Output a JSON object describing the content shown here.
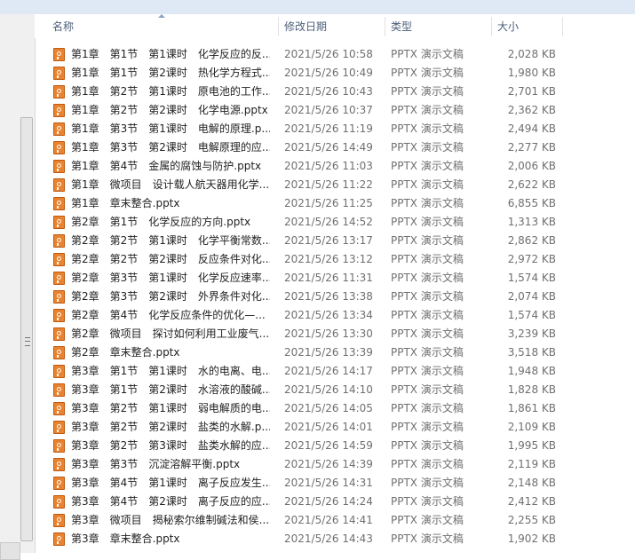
{
  "columns": {
    "name": "名称",
    "date": "修改日期",
    "type": "类型",
    "size": "大小"
  },
  "files": [
    {
      "name": "第1章　第1节　第1课时　化学反应的反...",
      "date": "2021/5/26 10:58",
      "type": "PPTX 演示文稿",
      "size": "2,028 KB"
    },
    {
      "name": "第1章　第1节　第2课时　热化学方程式...",
      "date": "2021/5/26 10:49",
      "type": "PPTX 演示文稿",
      "size": "1,980 KB"
    },
    {
      "name": "第1章　第2节　第1课时　原电池的工作...",
      "date": "2021/5/26 10:43",
      "type": "PPTX 演示文稿",
      "size": "2,701 KB"
    },
    {
      "name": "第1章　第2节　第2课时　化学电源.pptx",
      "date": "2021/5/26 10:37",
      "type": "PPTX 演示文稿",
      "size": "2,362 KB"
    },
    {
      "name": "第1章　第3节　第1课时　电解的原理.p...",
      "date": "2021/5/26 11:19",
      "type": "PPTX 演示文稿",
      "size": "2,494 KB"
    },
    {
      "name": "第1章　第3节　第2课时　电解原理的应...",
      "date": "2021/5/26 14:49",
      "type": "PPTX 演示文稿",
      "size": "2,277 KB"
    },
    {
      "name": "第1章　第4节　金属的腐蚀与防护.pptx",
      "date": "2021/5/26 11:03",
      "type": "PPTX 演示文稿",
      "size": "2,006 KB"
    },
    {
      "name": "第1章　微项目　设计载人航天器用化学...",
      "date": "2021/5/26 11:22",
      "type": "PPTX 演示文稿",
      "size": "2,622 KB"
    },
    {
      "name": "第1章　章末整合.pptx",
      "date": "2021/5/26 11:25",
      "type": "PPTX 演示文稿",
      "size": "6,855 KB"
    },
    {
      "name": "第2章　第1节　化学反应的方向.pptx",
      "date": "2021/5/26 14:52",
      "type": "PPTX 演示文稿",
      "size": "1,313 KB"
    },
    {
      "name": "第2章　第2节　第1课时　化学平衡常数...",
      "date": "2021/5/26 13:17",
      "type": "PPTX 演示文稿",
      "size": "2,862 KB"
    },
    {
      "name": "第2章　第2节　第2课时　反应条件对化...",
      "date": "2021/5/26 13:12",
      "type": "PPTX 演示文稿",
      "size": "2,972 KB"
    },
    {
      "name": "第2章　第3节　第1课时　化学反应速率...",
      "date": "2021/5/26 11:31",
      "type": "PPTX 演示文稿",
      "size": "1,574 KB"
    },
    {
      "name": "第2章　第3节　第2课时　外界条件对化...",
      "date": "2021/5/26 13:38",
      "type": "PPTX 演示文稿",
      "size": "2,074 KB"
    },
    {
      "name": "第2章　第4节　化学反应条件的优化—...",
      "date": "2021/5/26 13:34",
      "type": "PPTX 演示文稿",
      "size": "1,574 KB"
    },
    {
      "name": "第2章　微项目　探讨如何利用工业废气...",
      "date": "2021/5/26 13:30",
      "type": "PPTX 演示文稿",
      "size": "3,239 KB"
    },
    {
      "name": "第2章　章末整合.pptx",
      "date": "2021/5/26 13:39",
      "type": "PPTX 演示文稿",
      "size": "3,518 KB"
    },
    {
      "name": "第3章　第1节　第1课时　水的电离、电...",
      "date": "2021/5/26 14:17",
      "type": "PPTX 演示文稿",
      "size": "1,948 KB"
    },
    {
      "name": "第3章　第1节　第2课时　水溶液的酸碱...",
      "date": "2021/5/26 14:10",
      "type": "PPTX 演示文稿",
      "size": "1,828 KB"
    },
    {
      "name": "第3章　第2节　第1课时　弱电解质的电...",
      "date": "2021/5/26 14:05",
      "type": "PPTX 演示文稿",
      "size": "1,861 KB"
    },
    {
      "name": "第3章　第2节　第2课时　盐类的水解.p...",
      "date": "2021/5/26 14:01",
      "type": "PPTX 演示文稿",
      "size": "2,109 KB"
    },
    {
      "name": "第3章　第2节　第3课时　盐类水解的应...",
      "date": "2021/5/26 14:59",
      "type": "PPTX 演示文稿",
      "size": "1,995 KB"
    },
    {
      "name": "第3章　第3节　沉淀溶解平衡.pptx",
      "date": "2021/5/26 14:39",
      "type": "PPTX 演示文稿",
      "size": "2,119 KB"
    },
    {
      "name": "第3章　第4节　第1课时　离子反应发生...",
      "date": "2021/5/26 14:31",
      "type": "PPTX 演示文稿",
      "size": "2,148 KB"
    },
    {
      "name": "第3章　第4节　第2课时　离子反应的应...",
      "date": "2021/5/26 14:24",
      "type": "PPTX 演示文稿",
      "size": "2,412 KB"
    },
    {
      "name": "第3章　微项目　揭秘索尔维制碱法和侯...",
      "date": "2021/5/26 14:41",
      "type": "PPTX 演示文稿",
      "size": "2,255 KB"
    },
    {
      "name": "第3章　章末整合.pptx",
      "date": "2021/5/26 14:43",
      "type": "PPTX 演示文稿",
      "size": "1,902 KB"
    }
  ]
}
